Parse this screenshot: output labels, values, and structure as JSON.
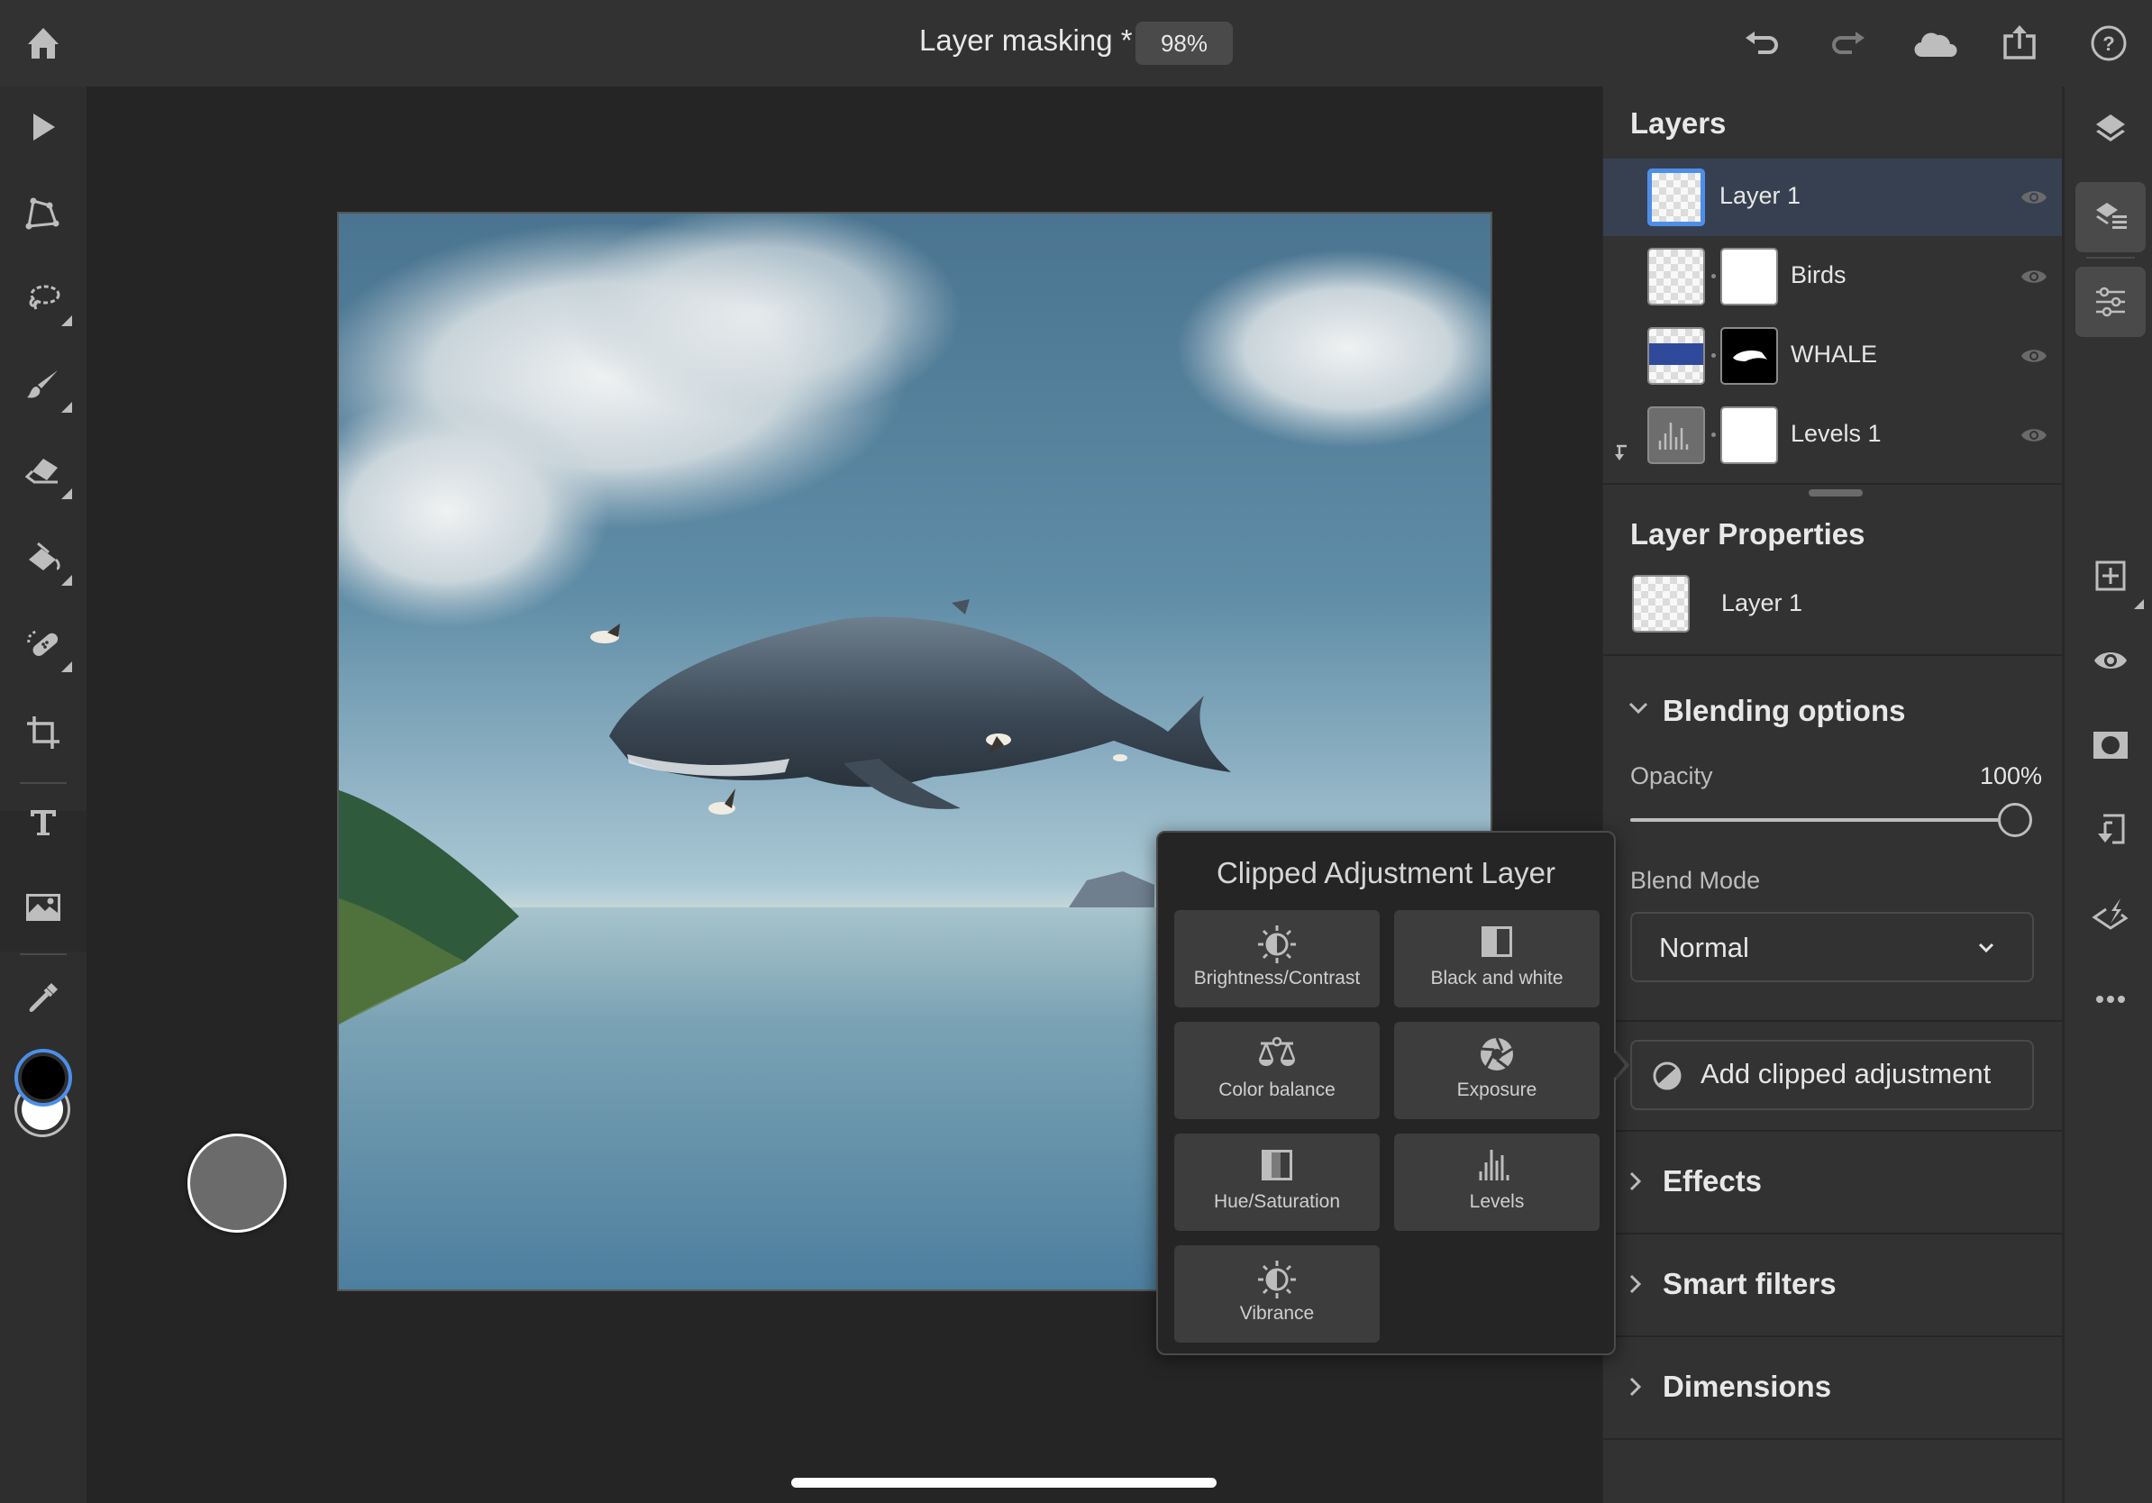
{
  "header": {
    "document_title": "Layer masking *",
    "zoom_level": "98%",
    "icons": [
      "home-icon",
      "undo-icon",
      "redo-icon",
      "cloud-icon",
      "share-icon",
      "help-icon"
    ]
  },
  "toolbar": {
    "tools": [
      {
        "name": "select-tool",
        "icon": "arrow-pointer-icon"
      },
      {
        "name": "transform-tool",
        "icon": "transform-icon"
      },
      {
        "name": "lasso-tool",
        "icon": "lasso-icon",
        "has_submenu": true
      },
      {
        "name": "brush-tool",
        "icon": "brush-icon",
        "has_submenu": true
      },
      {
        "name": "eraser-tool",
        "icon": "eraser-icon",
        "has_submenu": true
      },
      {
        "name": "fill-tool",
        "icon": "paint-bucket-icon",
        "has_submenu": true
      },
      {
        "name": "healing-tool",
        "icon": "bandage-icon",
        "has_submenu": true
      },
      {
        "name": "crop-tool",
        "icon": "crop-icon"
      },
      {
        "name": "type-tool",
        "icon": "type-icon"
      },
      {
        "name": "place-image-tool",
        "icon": "image-icon"
      },
      {
        "name": "eyedropper-tool",
        "icon": "eyedropper-icon"
      }
    ],
    "foreground_color": "#000000",
    "background_color": "#ffffff"
  },
  "layers_panel": {
    "title": "Layers",
    "layers": [
      {
        "name": "Layer 1",
        "selected": true,
        "visible": true,
        "has_mask": false
      },
      {
        "name": "Birds",
        "selected": false,
        "visible": true,
        "has_mask": true
      },
      {
        "name": "WHALE",
        "selected": false,
        "visible": true,
        "has_mask": true
      },
      {
        "name": "Levels 1",
        "selected": false,
        "visible": true,
        "has_mask": true,
        "clipped": true
      }
    ]
  },
  "layer_properties": {
    "title": "Layer Properties",
    "layer_name": "Layer 1",
    "blending": {
      "title": "Blending options",
      "expanded": true,
      "opacity_label": "Opacity",
      "opacity_value": "100%",
      "opacity_fraction": 1.0,
      "blend_mode_label": "Blend Mode",
      "blend_mode_value": "Normal"
    },
    "add_clipped_label": "Add clipped adjustment",
    "sections": [
      {
        "title": "Effects",
        "expanded": false
      },
      {
        "title": "Smart filters",
        "expanded": false
      },
      {
        "title": "Dimensions",
        "expanded": false
      }
    ]
  },
  "right_rail": {
    "buttons": [
      "layers-icon",
      "layer-properties-icon",
      "adjustments-icon",
      "add-layer-icon",
      "visibility-icon",
      "mask-icon",
      "clip-icon",
      "quick-actions-icon",
      "more-icon"
    ]
  },
  "popover": {
    "title": "Clipped Adjustment Layer",
    "items": [
      {
        "label": "Brightness/Contrast",
        "icon": "brightness-contrast-icon"
      },
      {
        "label": "Black and white",
        "icon": "black-white-icon"
      },
      {
        "label": "Color balance",
        "icon": "color-balance-icon"
      },
      {
        "label": "Exposure",
        "icon": "exposure-icon"
      },
      {
        "label": "Hue/Saturation",
        "icon": "hue-saturation-icon"
      },
      {
        "label": "Levels",
        "icon": "levels-icon"
      },
      {
        "label": "Vibrance",
        "icon": "vibrance-icon"
      }
    ]
  },
  "colors": {
    "accent": "#4d8fe8",
    "selected_row": "#374050",
    "panel_bg": "#323232",
    "canvas_bg": "#252525"
  }
}
